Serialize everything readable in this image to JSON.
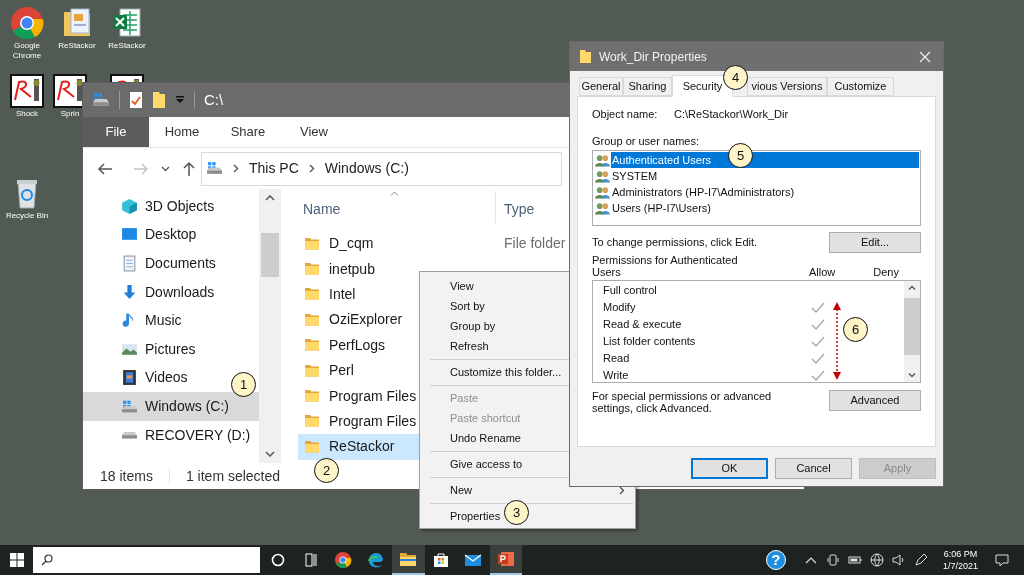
{
  "desktop_icons": [
    {
      "kind": "browser",
      "label": "Google Chrome"
    },
    {
      "kind": "document",
      "label": "ReStackor"
    },
    {
      "kind": "spreadsheet",
      "label": "ReStackor"
    },
    {
      "kind": "sketch",
      "label": "Shock"
    },
    {
      "kind": "sketch",
      "label": "Sprin"
    },
    {
      "kind": "sketch"
    },
    {
      "kind": "recycle",
      "label": "Recycle Bin"
    }
  ],
  "explorer": {
    "title": "C:\\",
    "ribbon_tabs": [
      {
        "kind": "file",
        "label": "File"
      },
      {
        "kind": "tab",
        "label": "Home"
      },
      {
        "kind": "tab",
        "label": "Share"
      },
      {
        "kind": "tab",
        "label": "View"
      }
    ],
    "address": [
      "This PC",
      "Windows (C:)"
    ],
    "nav_items": [
      {
        "kind": "cube",
        "label": "3D Objects",
        "selected": false
      },
      {
        "kind": "desktop",
        "label": "Desktop",
        "selected": false
      },
      {
        "kind": "documents",
        "label": "Documents",
        "selected": false
      },
      {
        "kind": "downloads",
        "label": "Downloads",
        "selected": false
      },
      {
        "kind": "music",
        "label": "Music",
        "selected": false
      },
      {
        "kind": "pictures",
        "label": "Pictures",
        "selected": false
      },
      {
        "kind": "videos",
        "label": "Videos",
        "selected": false
      },
      {
        "kind": "windows-drive",
        "label": "Windows (C:)",
        "selected": true
      },
      {
        "kind": "drive",
        "label": "RECOVERY (D:)",
        "selected": false
      }
    ],
    "columns": [
      "Name",
      "Type"
    ],
    "rows": [
      {
        "name": "D_cqm",
        "type": "File folder",
        "selected": false
      },
      {
        "name": "inetpub",
        "selected": false
      },
      {
        "name": "Intel",
        "selected": false
      },
      {
        "name": "OziExplorer",
        "selected": false
      },
      {
        "name": "PerfLogs",
        "selected": false
      },
      {
        "name": "Perl",
        "selected": false
      },
      {
        "name": "Program Files",
        "selected": false
      },
      {
        "name": "Program Files",
        "selected": false
      },
      {
        "name": "ReStackor",
        "selected": true
      }
    ],
    "status": [
      "18 items",
      "1 item selected"
    ]
  },
  "context_menu": [
    {
      "kind": "item",
      "label": "View",
      "disabled": false,
      "submenu": false
    },
    {
      "kind": "item",
      "label": "Sort by",
      "disabled": false,
      "submenu": false
    },
    {
      "kind": "item",
      "label": "Group by",
      "disabled": false,
      "submenu": false
    },
    {
      "kind": "item",
      "label": "Refresh",
      "disabled": false,
      "submenu": false
    },
    {
      "kind": "separator"
    },
    {
      "kind": "item",
      "label": "Customize this folder...",
      "disabled": false,
      "submenu": false
    },
    {
      "kind": "separator"
    },
    {
      "kind": "item",
      "label": "Paste",
      "disabled": true,
      "submenu": false
    },
    {
      "kind": "item",
      "label": "Paste shortcut",
      "disabled": true,
      "submenu": false
    },
    {
      "kind": "item",
      "label": "Undo Rename",
      "disabled": false,
      "submenu": false
    },
    {
      "kind": "separator"
    },
    {
      "kind": "item",
      "label": "Give access to",
      "disabled": false,
      "submenu": false
    },
    {
      "kind": "separator"
    },
    {
      "kind": "item",
      "label": "New",
      "disabled": false,
      "submenu": true
    },
    {
      "kind": "separator"
    },
    {
      "kind": "item",
      "label": "Properties",
      "disabled": false,
      "submenu": false
    }
  ],
  "properties": {
    "title": "Work_Dir Properties",
    "tabs": [
      {
        "label": "General",
        "selected": false
      },
      {
        "label": "Sharing",
        "selected": false
      },
      {
        "label": "Security",
        "selected": true
      },
      {
        "label": "vious Versions",
        "selected": false
      },
      {
        "label": "Customize",
        "selected": false
      }
    ],
    "object_label": "Object name:",
    "object_value": "C:\\ReStackor\\Work_Dir",
    "groups_label": "Group or user names:",
    "groups": [
      {
        "name": "Authenticated Users",
        "selected": true
      },
      {
        "name": "SYSTEM",
        "selected": false
      },
      {
        "name": "Administrators (HP-I7\\Administrators)",
        "selected": false
      },
      {
        "name": "Users (HP-I7\\Users)",
        "selected": false
      }
    ],
    "edit_hint": "To change permissions, click Edit.",
    "edit_button": "Edit...",
    "permissions_label": "Permissions for Authenticated Users",
    "allow_header": "Allow",
    "deny_header": "Deny",
    "permissions": [
      {
        "name": "Full control",
        "allow": false
      },
      {
        "name": "Modify",
        "allow": true
      },
      {
        "name": "Read & execute",
        "allow": true
      },
      {
        "name": "List folder contents",
        "allow": true
      },
      {
        "name": "Read",
        "allow": true
      },
      {
        "name": "Write",
        "allow": true
      }
    ],
    "advanced_hint": "For special permissions or advanced settings, click Advanced.",
    "advanced_button": "Advanced",
    "buttons": [
      {
        "label": "OK",
        "kind": "default"
      },
      {
        "label": "Cancel",
        "kind": "normal"
      },
      {
        "label": "Apply",
        "kind": "disabled"
      }
    ]
  },
  "callouts": [
    "1",
    "2",
    "3",
    "4",
    "5",
    "6"
  ],
  "taskbar": {
    "apps": [
      {
        "kind": "cortana",
        "active": false
      },
      {
        "kind": "task-view",
        "active": false
      },
      {
        "kind": "browser",
        "active": false
      },
      {
        "kind": "edge",
        "active": false
      },
      {
        "kind": "explorer",
        "active": true
      },
      {
        "kind": "store",
        "active": false
      },
      {
        "kind": "mail",
        "active": false
      },
      {
        "kind": "slides",
        "active": true
      }
    ],
    "help": "?",
    "time": "6:06 PM",
    "date": "1/7/2021"
  }
}
